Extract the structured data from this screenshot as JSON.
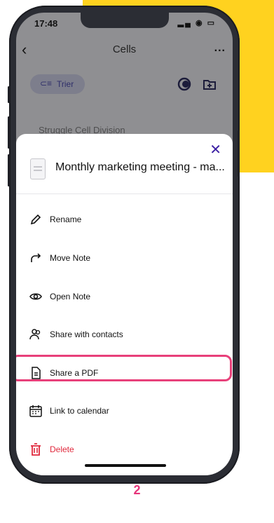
{
  "status_bar": {
    "time": "17:48",
    "icons": "▂▄ ◉ ▭"
  },
  "nav": {
    "title": "Cells",
    "back": "‹",
    "more": "..."
  },
  "toolbar": {
    "sort_label": "Trier",
    "sort_icon": "⊂≡"
  },
  "background_row": {
    "label": "Struggle Cell Division"
  },
  "sheet": {
    "note_title": "Monthly marketing meeting - ma...",
    "close": "✕",
    "menu": [
      {
        "label": "Rename",
        "icon": "pencil-icon"
      },
      {
        "label": "Move Note",
        "icon": "redo-arrow-icon"
      },
      {
        "label": "Open Note",
        "icon": "eye-icon"
      },
      {
        "label": "Share with contacts",
        "icon": "contacts-icon"
      },
      {
        "label": "Share a PDF",
        "icon": "document-icon"
      },
      {
        "label": "Link to calendar",
        "icon": "calendar-icon"
      },
      {
        "label": "Delete",
        "icon": "trash-icon"
      }
    ]
  },
  "step_number": "2",
  "colors": {
    "accent_yellow": "#ffd21f",
    "highlight_pink": "#e8407a",
    "danger": "#e0283c",
    "brand_purple": "#3b1fa3"
  }
}
